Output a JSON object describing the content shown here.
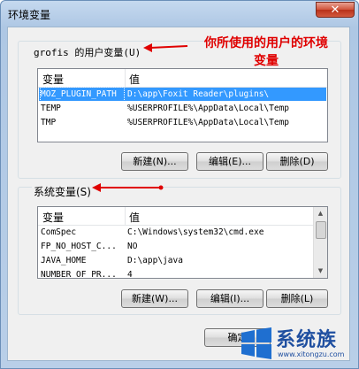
{
  "window": {
    "title": "环境变量",
    "close_label": "✕"
  },
  "user_vars": {
    "group_label": "grofis 的用户变量(U)",
    "columns": [
      "变量",
      "值"
    ],
    "rows": [
      {
        "name": "MOZ_PLUGIN_PATH",
        "value": "D:\\app\\Foxit Reader\\plugins\\"
      },
      {
        "name": "TEMP",
        "value": "%USERPROFILE%\\AppData\\Local\\Temp"
      },
      {
        "name": "TMP",
        "value": "%USERPROFILE%\\AppData\\Local\\Temp"
      }
    ],
    "new_label": "新建(N)...",
    "edit_label": "编辑(E)...",
    "delete_label": "删除(D)"
  },
  "system_vars": {
    "group_label": "系统变量(S)",
    "columns": [
      "变量",
      "值"
    ],
    "rows": [
      {
        "name": "ComSpec",
        "value": "C:\\Windows\\system32\\cmd.exe"
      },
      {
        "name": "FP_NO_HOST_C...",
        "value": "NO"
      },
      {
        "name": "JAVA_HOME",
        "value": "D:\\app\\java"
      },
      {
        "name": "NUMBER_OF_PR...",
        "value": "4"
      }
    ],
    "new_label": "新建(W)...",
    "edit_label": "编辑(I)...",
    "delete_label": "删除(L)"
  },
  "footer": {
    "ok_label": "确定"
  },
  "annotation": {
    "line1": "你所使用的用户的环境",
    "line2": "变量"
  },
  "watermark": {
    "brand": "系统族",
    "url": "www.xitongzu.com"
  },
  "colors": {
    "annotation": "#e00000",
    "selection": "#3399ff"
  }
}
